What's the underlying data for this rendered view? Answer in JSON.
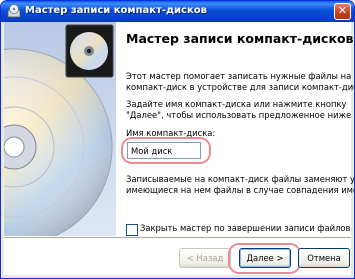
{
  "window": {
    "title": "Мастер записи компакт-дисков",
    "close_glyph": "✕"
  },
  "wizard": {
    "heading": "Мастер записи компакт-дисков",
    "intro_line1": "Этот мастер помогает записать нужные файлы на",
    "intro_line2": "компакт-диск в устройстве для записи компакт-дисков.",
    "prompt_line1": "Задайте имя компакт-диска или нажмите кнопку",
    "prompt_line2": "\"Далее\", чтобы использовать предложенное ниже имя.",
    "name_label": "Имя компакт-диска:",
    "name_value": "Мой диск",
    "warning_line1": "Записываемые на компакт-диск файлы заменяют уже",
    "warning_line2": "имеющиеся на нем файлы в случае совпадения имен.",
    "close_when_done_label": "Закрыть мастер по завершении записи файлов",
    "close_when_done_checked": false
  },
  "buttons": {
    "back": "< Назад",
    "next": "Далее >",
    "cancel": "Отмена"
  },
  "icons": [
    "cd-burner-icon",
    "cd-disc-illustration",
    "close-icon"
  ],
  "colors": {
    "titlebar": "#0a4fd9",
    "highlight": "#f08a92",
    "button_border": "#003c74"
  }
}
